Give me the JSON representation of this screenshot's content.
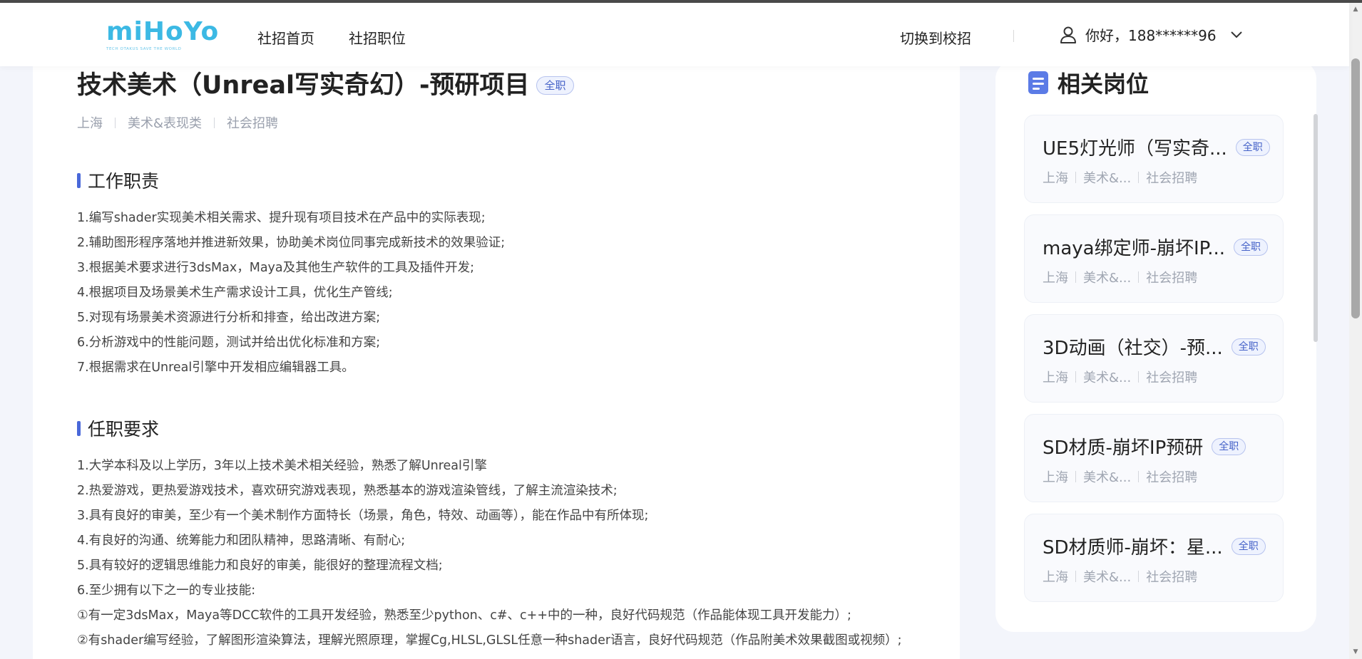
{
  "header": {
    "logo": "miHoYo",
    "logo_tagline": "TECH OTAKUS SAVE THE WORLD",
    "nav": [
      "社招首页",
      "社招职位"
    ],
    "switch_link": "切换到校招",
    "user_greeting": "你好，188******96",
    "icons": [
      "user-icon",
      "chevron-down-icon"
    ]
  },
  "job": {
    "title": "技术美术（Unreal写实奇幻）-预研项目",
    "type_tag": "全职",
    "meta": [
      "上海",
      "美术&表现类",
      "社会招聘"
    ],
    "duties_title": "工作职责",
    "duties": [
      "1.编写shader实现美术相关需求、提升现有项目技术在产品中的实际表现;",
      "2.辅助图形程序落地并推进新效果，协助美术岗位同事完成新技术的效果验证;",
      "3.根据美术要求进行3dsMax，Maya及其他生产软件的工具及插件开发;",
      "4.根据项目及场景美术生产需求设计工具，优化生产管线;",
      "5.对现有场景美术资源进行分析和排查，给出改进方案;",
      "6.分析游戏中的性能问题，测试并给出优化标准和方案;",
      "7.根据需求在Unreal引擎中开发相应编辑器工具。"
    ],
    "requirements_title": "任职要求",
    "requirements": [
      "1.大学本科及以上学历，3年以上技术美术相关经验，熟悉了解Unreal引擎",
      "2.热爱游戏，更热爱游戏技术，喜欢研究游戏表现，熟悉基本的游戏渲染管线，了解主流渲染技术;",
      "3.具有良好的审美，至少有一个美术制作方面特长（场景，角色，特效、动画等），能在作品中有所体现;",
      "4.有良好的沟通、统筹能力和团队精神，思路清晰、有耐心;",
      "5.具有较好的逻辑思维能力和良好的审美，能很好的整理流程文档;",
      "6.至少拥有以下之一的专业技能:",
      "①有一定3dsMax，Maya等DCC软件的工具开发经验，熟悉至少python、c#、c++中的一种，良好代码规范（作品能体现工具开发能力）;",
      "②有shader编写经验，了解图形渲染算法，理解光照原理，掌握Cg,HLSL,GLSL任意一种shader语言，良好代码规范（作品附美术效果截图或视频）;"
    ]
  },
  "sidebar": {
    "title": "相关岗位",
    "jobs": [
      {
        "title": "UE5灯光师（写实奇...",
        "tag": "全职",
        "location": "上海",
        "category": "美术&...",
        "recruit": "社会招聘"
      },
      {
        "title": "maya绑定师-崩坏IP...",
        "tag": "全职",
        "location": "上海",
        "category": "美术&...",
        "recruit": "社会招聘"
      },
      {
        "title": "3D动画（社交）-预...",
        "tag": "全职",
        "location": "上海",
        "category": "美术&...",
        "recruit": "社会招聘"
      },
      {
        "title": "SD材质-崩坏IP预研",
        "tag": "全职",
        "location": "上海",
        "category": "美术&...",
        "recruit": "社会招聘"
      },
      {
        "title": "SD材质师-崩坏：星...",
        "tag": "全职",
        "location": "上海",
        "category": "美术&...",
        "recruit": "社会招聘"
      }
    ]
  }
}
